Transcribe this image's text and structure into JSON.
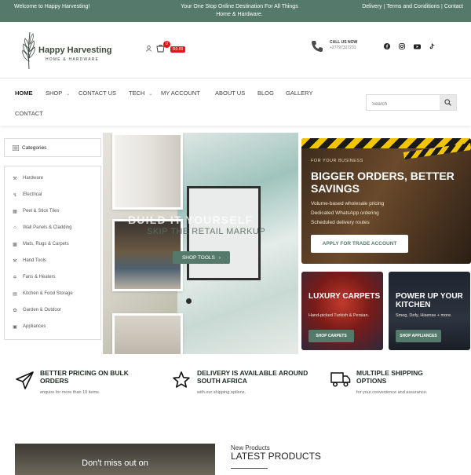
{
  "topbar": {
    "welcome": "Welcome to Happy Harvesting!",
    "tagline": "Your One Stop Online Destination For All Things Home & Hardware.",
    "links": [
      "Delivery",
      "Terms and Conditions",
      "Contact"
    ],
    "bg": "#557a6b"
  },
  "header": {
    "brand": "Happy Harvesting",
    "brand_sub": "HOME & HARDWARE",
    "cart_count": "0",
    "cart_total": "R0.00",
    "call_label": "CALL US NOW",
    "call_number": "+27797327231",
    "socials": [
      "facebook-icon",
      "instagram-icon",
      "youtube-icon",
      "tiktok-icon"
    ]
  },
  "nav": {
    "items": [
      "HOME",
      "SHOP",
      "CONTACT US",
      "TECH",
      "MY ACCOUNT",
      "ABOUT US",
      "BLOG",
      "GALLERY",
      "CONTACT"
    ],
    "search_placeholder": "Search"
  },
  "categories": {
    "title": "Categories",
    "items": [
      "Hardware",
      "Electrical",
      "Peel & Stick Tiles",
      "Wall Panels & Cladding",
      "Mats, Rugs & Carpets",
      "Hand Tools",
      "Fans & Heaters",
      "Kitchen & Food Storage",
      "Garden & Outdoor",
      "Appliances"
    ]
  },
  "hero": {
    "title": "BUILD IT YOURSELF",
    "subtitle": "SKIP THE RETAIL MARKUP",
    "button": "SHOP TOOLS"
  },
  "trade": {
    "kicker": "FOR YOUR BUSINESS",
    "title": "BIGGER ORDERS, BETTER SAVINGS",
    "features": [
      "Volume-based wholesale pricing",
      "Dedicated WhatsApp ordering",
      "Scheduled delivery routes"
    ],
    "button": "APPLY FOR TRADE ACCOUNT"
  },
  "promos": [
    {
      "title": "LUXURY CARPETS",
      "desc": "Hand-picked Turkish & Persian.",
      "button": "SHOP CARPETS"
    },
    {
      "title": "POWER UP YOUR KITCHEN",
      "desc": "Smeg, Defy, Hisense + more.",
      "button": "SHOP APPLIANCES"
    }
  ],
  "features": [
    {
      "title": "BETTER PRICING ON BULK ORDERS",
      "desc": "enquire for more than 10 items."
    },
    {
      "title": "DELIVERY IS AVAILABLE AROUND SOUTH AFRICA",
      "desc": "with our shipping options."
    },
    {
      "title": "MULTIPLE SHIPPING OPTIONS",
      "desc": "for your convenience and assurance."
    }
  ],
  "bottom": {
    "deal_text": "Don't miss out on",
    "np_small": "New Products",
    "np_big": "LATEST PRODUCTS"
  }
}
